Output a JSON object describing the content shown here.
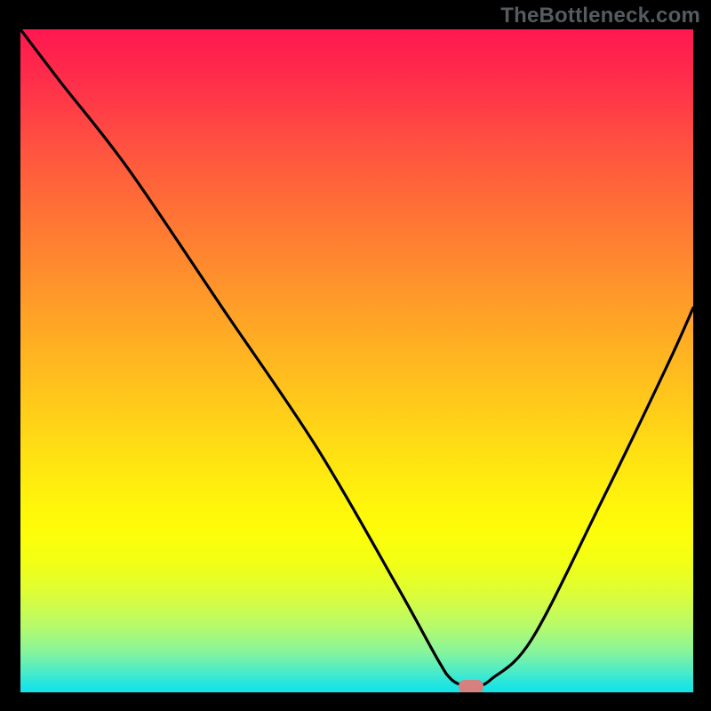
{
  "watermark": "TheBottleneck.com",
  "chart_data": {
    "type": "line",
    "title": "",
    "xlabel": "",
    "ylabel": "",
    "xlim": [
      0,
      100
    ],
    "ylim": [
      0,
      100
    ],
    "x": [
      0,
      6,
      16,
      30,
      44,
      56,
      62,
      64,
      66,
      68,
      70,
      76,
      86,
      96,
      100
    ],
    "values": [
      100,
      92,
      79,
      58,
      37,
      16,
      5,
      2,
      1,
      1,
      2,
      8,
      28,
      49,
      58
    ],
    "marker": {
      "x": 67,
      "y": 1
    },
    "gradient_colors": {
      "top": "#ff1750",
      "mid_upper": "#ffb122",
      "mid": "#fff60b",
      "mid_lower": "#b7fa6b",
      "bottom": "#14e2e8"
    }
  }
}
